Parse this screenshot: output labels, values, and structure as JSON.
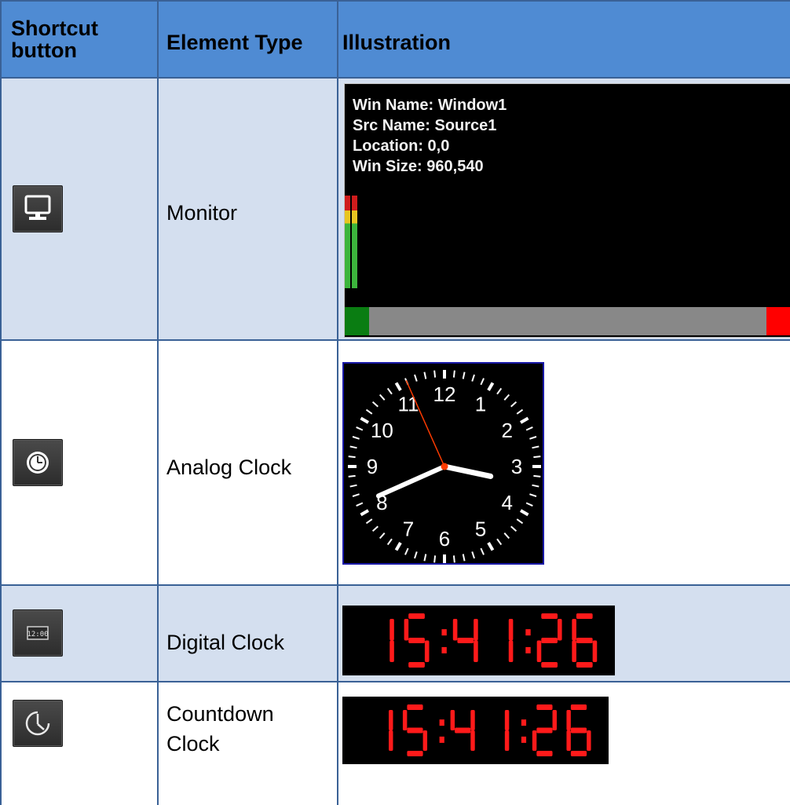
{
  "table": {
    "headers": [
      "Shortcut button",
      "Element Type",
      "Illustration"
    ],
    "header_shortcut_line1": "Shortcut",
    "header_shortcut_line2": "button",
    "rows": [
      {
        "element_type": "Monitor",
        "icon": "monitor-icon"
      },
      {
        "element_type": "Analog Clock",
        "icon": "analog-clock-icon"
      },
      {
        "element_type": "Digital Clock",
        "icon": "digital-clock-icon"
      },
      {
        "element_type_line1": "Countdown",
        "element_type_line2": "Clock",
        "icon": "countdown-clock-icon"
      }
    ]
  },
  "monitor_preview": {
    "win_name": "Win Name:  Window1",
    "src_name": "Src Name:  Source1",
    "location": "Location:  0,0",
    "win_size": "Win Size:  960,540"
  },
  "analog_clock": {
    "numerals": [
      "12",
      "1",
      "2",
      "3",
      "4",
      "5",
      "6",
      "7",
      "8",
      "9",
      "10",
      "11"
    ],
    "hour": 3.4,
    "minute": 41,
    "second": 56
  },
  "digital_clock": {
    "time": "15:41:26"
  },
  "countdown_clock": {
    "time": "15:41:26"
  },
  "colors": {
    "header_bg": "#4f8bd3",
    "row_shade": "#d4dfef",
    "grid": "#3a6196",
    "segment_red": "#ff1a1a"
  }
}
